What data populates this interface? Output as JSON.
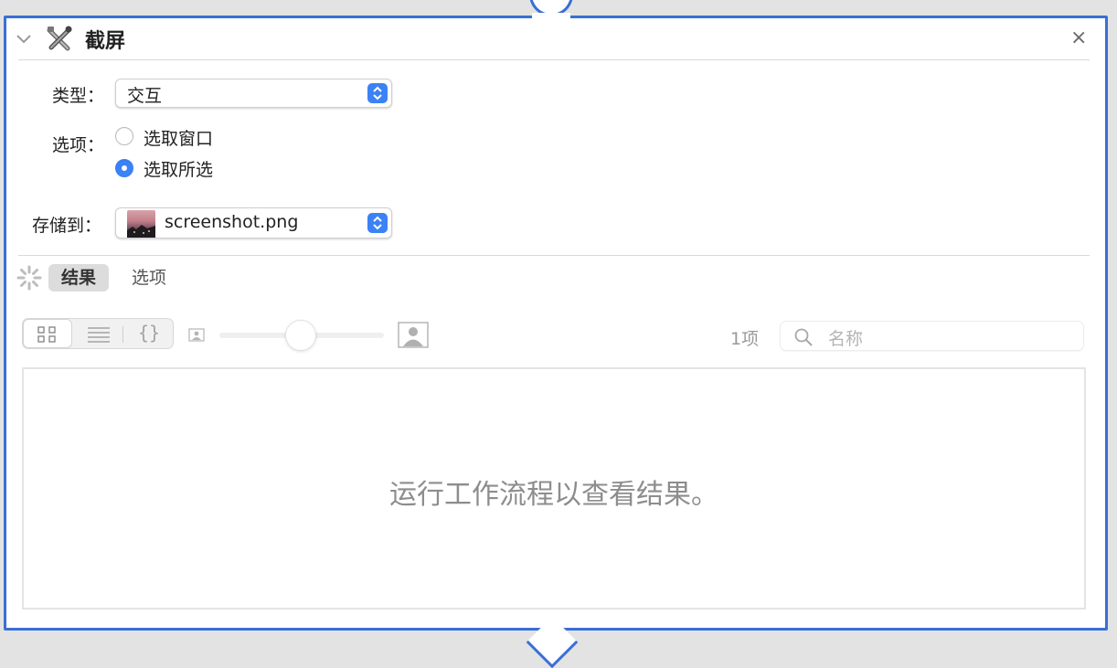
{
  "action": {
    "title": "截屏",
    "icon": "tools-icon",
    "close_label": "×"
  },
  "fields": {
    "type_label": "类型：",
    "type_value": "交互",
    "options_label": "选项：",
    "option_window": "选取窗口",
    "option_selection": "选取所选",
    "selected_option": "选取所选",
    "save_label": "存储到：",
    "save_value": "screenshot.png"
  },
  "tabs": [
    {
      "label": "结果",
      "active": true
    },
    {
      "label": "选项",
      "active": false
    }
  ],
  "results_toolbar": {
    "item_count": "1项",
    "search_placeholder": "名称",
    "view_modes": [
      "grid-view",
      "list-view",
      "code-view"
    ],
    "selected_view": "grid-view",
    "thumbnail_size": 0.5
  },
  "results_area": {
    "empty_message": "运行工作流程以查看结果。"
  },
  "colors": {
    "accent": "#3b82f6",
    "panel_border": "#3a6fd6"
  }
}
